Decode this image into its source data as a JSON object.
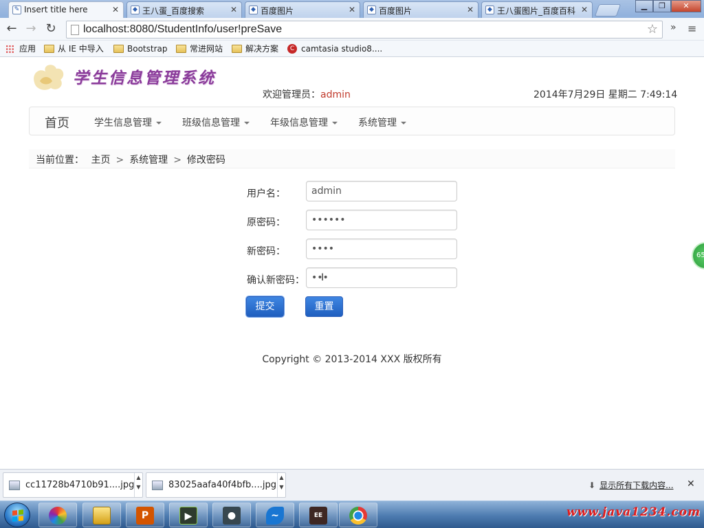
{
  "browser": {
    "tabs": [
      {
        "title": "Insert title here",
        "active": true
      },
      {
        "title": "王八蛋_百度搜索",
        "active": false
      },
      {
        "title": "百度图片",
        "active": false
      },
      {
        "title": "百度图片",
        "active": false
      },
      {
        "title": "王八蛋图片_百度百科",
        "active": false
      }
    ],
    "url": "localhost:8080/StudentInfo/user!preSave",
    "bookmarks": [
      "应用",
      "从 IE 中导入",
      "Bootstrap",
      "常进网站",
      "解决方案",
      "camtasia studio8...."
    ]
  },
  "header": {
    "site_title": "学生信息管理系统",
    "welcome_prefix": "欢迎管理员：",
    "welcome_user": "admin",
    "datetime": "2014年7月29日 星期二 7:49:14"
  },
  "nav": {
    "brand": "首页",
    "menus": [
      "学生信息管理",
      "班级信息管理",
      "年级信息管理",
      "系统管理"
    ]
  },
  "breadcrumb": {
    "prefix": "当前位置：",
    "items": [
      "主页",
      "系统管理",
      "修改密码"
    ]
  },
  "form": {
    "username_label": "用户名：",
    "username_value": "admin",
    "old_password_label": "原密码：",
    "old_password_value": "••••••",
    "new_password_label": "新密码：",
    "new_password_value": "••••",
    "confirm_password_label": "确认新密码：",
    "confirm_password_value": "•••",
    "submit_label": "提交",
    "reset_label": "重置"
  },
  "footer": {
    "copyright": "Copyright © 2013-2014 XXX 版权所有"
  },
  "side_badge": "65",
  "downloads": {
    "items": [
      "cc11728b4710b91....jpg",
      "83025aafa40f4bfb....jpg"
    ],
    "show_all": "显示所有下载内容..."
  },
  "taskbar": {
    "watermark": "www.java1234.com"
  },
  "colors": {
    "primary_button": "#1f5fbf",
    "admin_name": "#c0392b",
    "logo_text": "#8a3b9a"
  }
}
